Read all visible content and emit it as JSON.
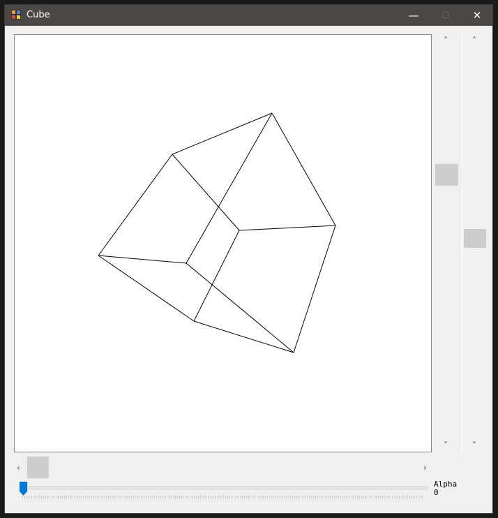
{
  "window": {
    "title": "Cube",
    "minimize_symbol": "—",
    "maximize_symbol": "☐",
    "close_symbol": "✕"
  },
  "scrollbars": {
    "up_arrow": "˄",
    "down_arrow": "˅",
    "left_arrow": "‹",
    "right_arrow": "›"
  },
  "slider": {
    "label": "Alpha",
    "value": "0"
  },
  "cube_edges": [
    [
      [
        246,
        220
      ],
      [
        389,
        161
      ]
    ],
    [
      [
        389,
        161
      ],
      [
        480,
        322
      ]
    ],
    [
      [
        480,
        322
      ],
      [
        342,
        329
      ]
    ],
    [
      [
        342,
        329
      ],
      [
        246,
        220
      ]
    ],
    [
      [
        140,
        365
      ],
      [
        266,
        376
      ]
    ],
    [
      [
        266,
        376
      ],
      [
        420,
        504
      ]
    ],
    [
      [
        420,
        504
      ],
      [
        277,
        459
      ]
    ],
    [
      [
        277,
        459
      ],
      [
        140,
        365
      ]
    ],
    [
      [
        246,
        220
      ],
      [
        140,
        365
      ]
    ],
    [
      [
        389,
        161
      ],
      [
        266,
        376
      ]
    ],
    [
      [
        480,
        322
      ],
      [
        420,
        504
      ]
    ],
    [
      [
        342,
        329
      ],
      [
        277,
        459
      ]
    ]
  ]
}
